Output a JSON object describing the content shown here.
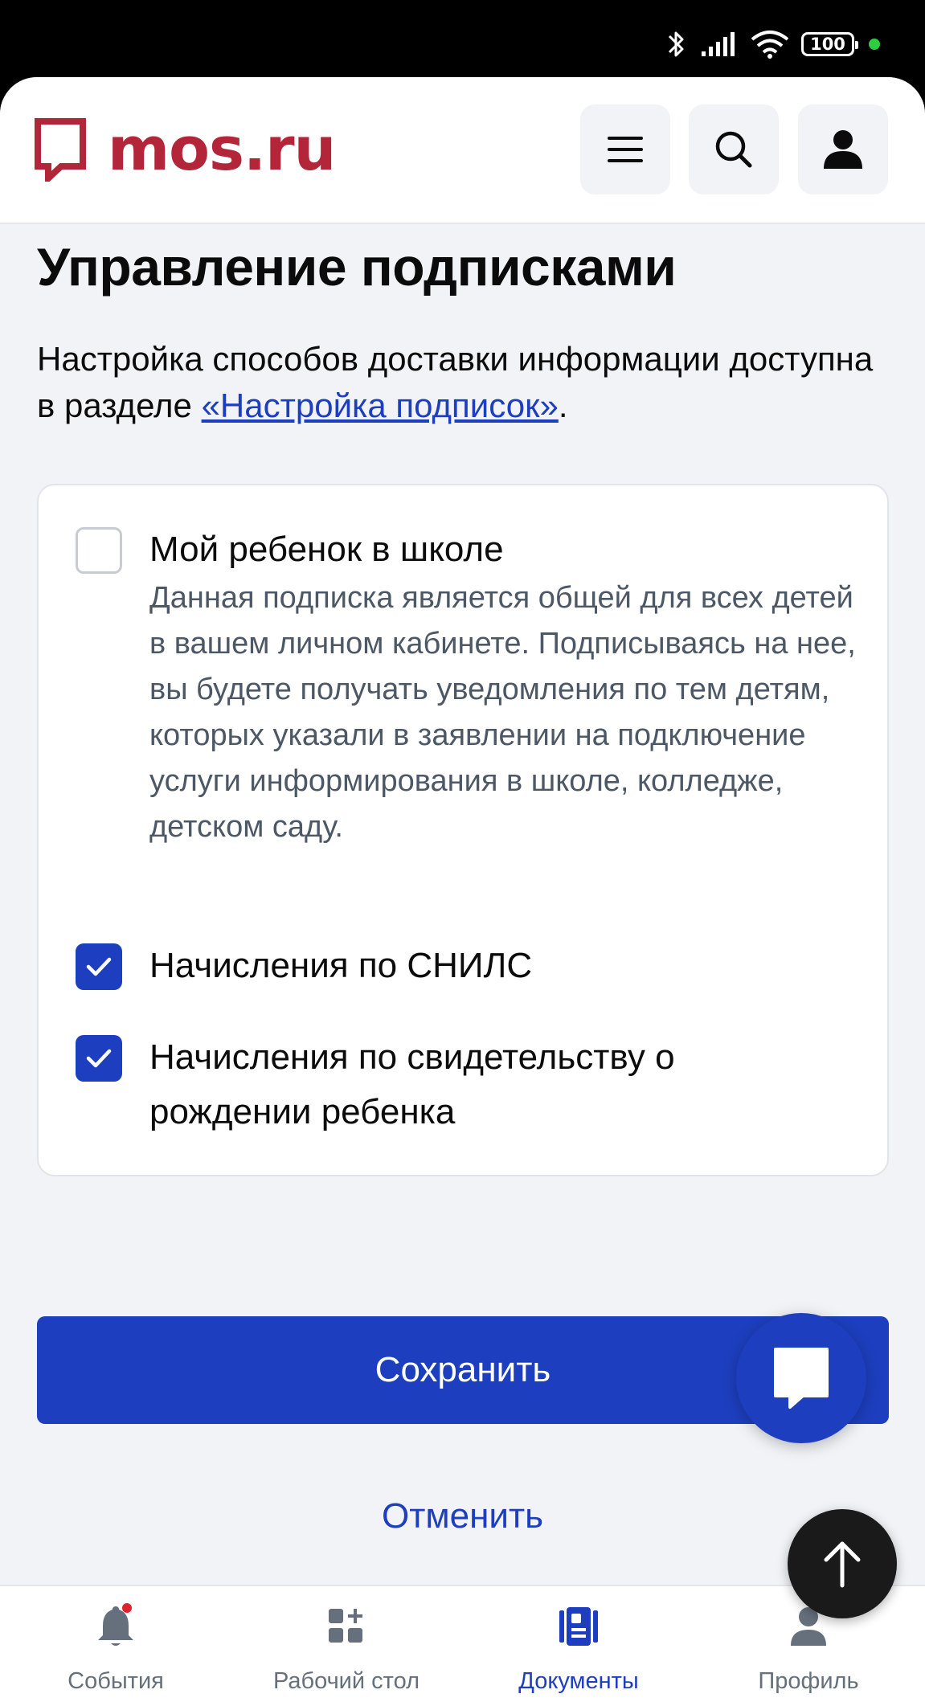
{
  "status": {
    "battery": "100"
  },
  "header": {
    "logo_text": "mos.ru"
  },
  "page": {
    "title": "Управление подписками",
    "intro_text": "Настройка способов доставки информации доступна в разделе ",
    "intro_link": "«Настройка подписок»",
    "intro_end": "."
  },
  "subscriptions": [
    {
      "label": "Мой ребенок в школе",
      "checked": false,
      "description": "Данная подписка является общей для всех детей в вашем личном кабинете. Подписываясь на нее, вы будете получать уведомления по тем детям, которых указали в заявлении на подключение услуги информирования в школе, колледже, детском саду."
    },
    {
      "label": "Начисления по СНИЛС",
      "checked": true
    },
    {
      "label": "Начисления по свидетельству о рождении ребенка",
      "checked": true
    }
  ],
  "actions": {
    "save_label": "Сохранить",
    "cancel_label": "Отменить"
  },
  "nav": {
    "items": [
      {
        "label": "События",
        "icon": "bell-icon",
        "badge": true
      },
      {
        "label": "Рабочий стол",
        "icon": "dashboard-icon"
      },
      {
        "label": "Документы",
        "icon": "documents-icon",
        "active": true
      },
      {
        "label": "Профиль",
        "icon": "profile-icon"
      }
    ]
  },
  "colors": {
    "brand_red": "#b3263a",
    "primary_blue": "#1d3fbf",
    "background": "#f1f3f6"
  }
}
